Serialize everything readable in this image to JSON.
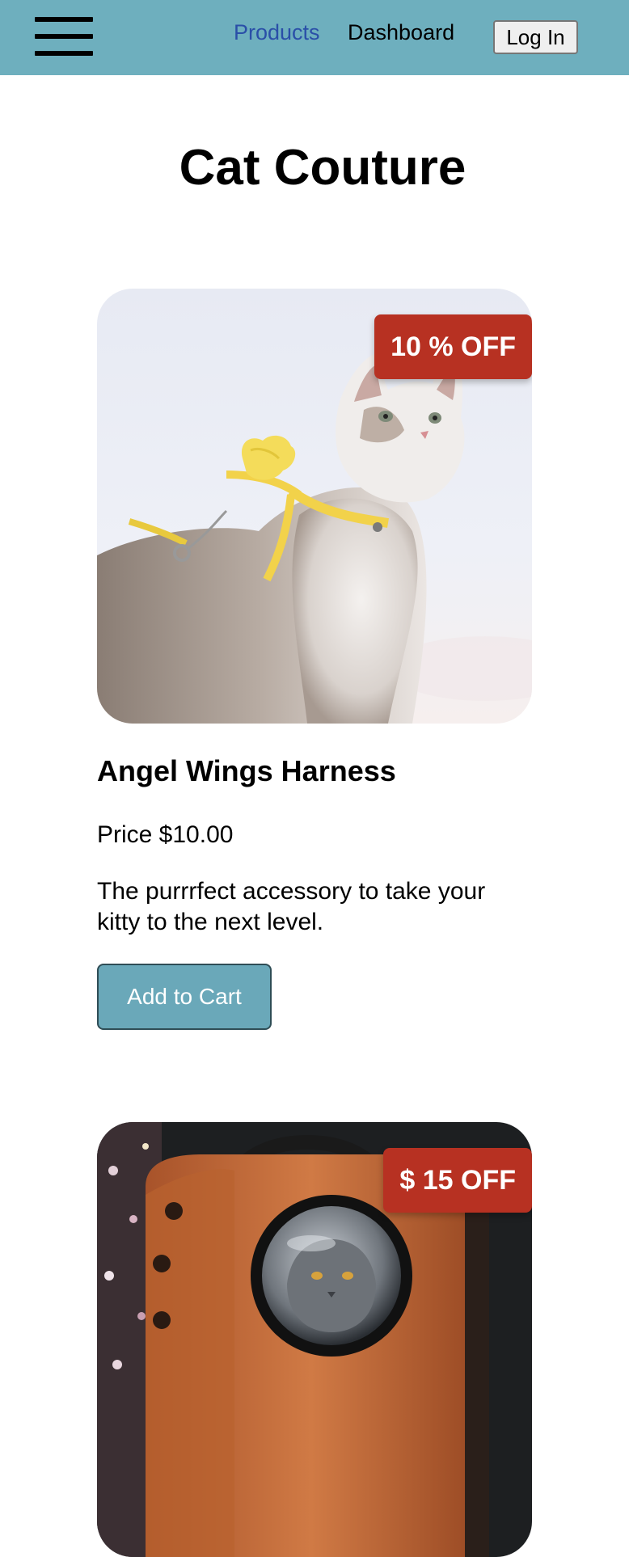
{
  "nav": {
    "menu_icon": "hamburger-menu-icon",
    "links": [
      {
        "label": "Products"
      },
      {
        "label": "Dashboard"
      }
    ],
    "login_label": "Log In"
  },
  "page": {
    "title": "Cat Couture"
  },
  "products": [
    {
      "badge": "10 % OFF",
      "name": "Angel Wings Harness",
      "price": "Price $10.00",
      "description": "The purrrfect accessory to take your kitty to the next level.",
      "button_label": "Add to Cart"
    },
    {
      "badge": "$ 15 OFF"
    }
  ],
  "colors": {
    "header_bg": "#6eafbe",
    "link_active": "#2a4fa8",
    "badge_bg": "#b73122",
    "button_bg": "#6aa8b9"
  }
}
